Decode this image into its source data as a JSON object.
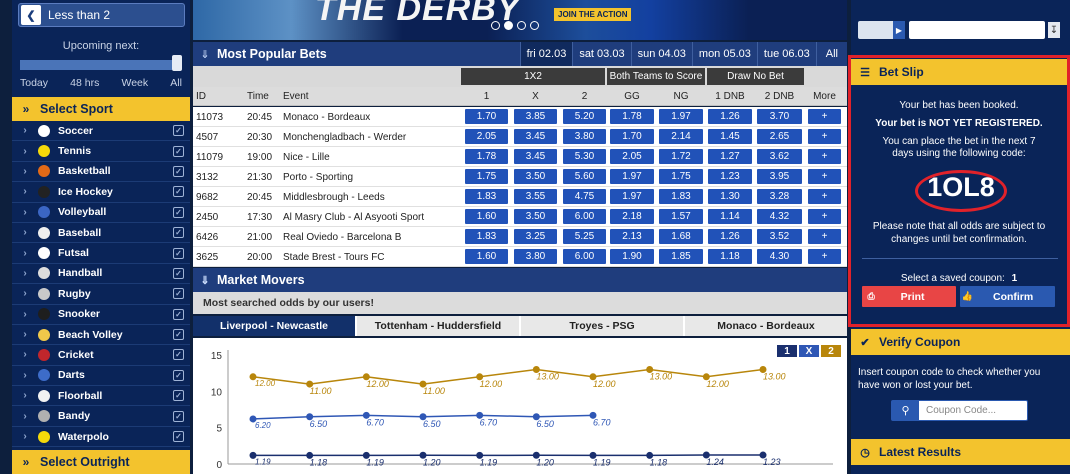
{
  "sidebar": {
    "range_select": "Less than 2",
    "upcoming_label": "Upcoming next:",
    "ranges": [
      "Today",
      "48 hrs",
      "Week",
      "All"
    ],
    "select_sport": "Select Sport",
    "sports": [
      {
        "name": "Soccer",
        "color": "#ffffff"
      },
      {
        "name": "Tennis",
        "color": "#f5d90a"
      },
      {
        "name": "Basketball",
        "color": "#e26a17"
      },
      {
        "name": "Ice Hockey",
        "color": "#222222"
      },
      {
        "name": "Volleyball",
        "color": "#3b66c4"
      },
      {
        "name": "Baseball",
        "color": "#eeeeee"
      },
      {
        "name": "Futsal",
        "color": "#ffffff"
      },
      {
        "name": "Handball",
        "color": "#dddddd"
      },
      {
        "name": "Rugby",
        "color": "#c9c9c9"
      },
      {
        "name": "Snooker",
        "color": "#1e1e1e"
      },
      {
        "name": "Beach Volley",
        "color": "#f0c84a"
      },
      {
        "name": "Cricket",
        "color": "#c0262c"
      },
      {
        "name": "Darts",
        "color": "#3d6cc9"
      },
      {
        "name": "Floorball",
        "color": "#f2f2f2"
      },
      {
        "name": "Bandy",
        "color": "#b0b0b0"
      },
      {
        "name": "Waterpolo",
        "color": "#f5d90a"
      }
    ],
    "select_outright": "Select Outright"
  },
  "banner": {
    "text": "THE DERBY",
    "cta": "JOIN THE ACTION"
  },
  "popular": {
    "title": "Most Popular Bets",
    "date_tabs": [
      "fri 02.03",
      "sat 03.03",
      "sun 04.03",
      "mon 05.03",
      "tue 06.03",
      "All"
    ],
    "groups": [
      "1X2",
      "Both Teams to Score",
      "Draw No Bet"
    ],
    "columns": [
      "ID",
      "Time",
      "Event",
      "1",
      "X",
      "2",
      "GG",
      "NG",
      "1 DNB",
      "2 DNB",
      "More"
    ],
    "rows": [
      {
        "id": "11073",
        "time": "20:45",
        "event": "Monaco - Bordeaux",
        "o1": "1.70",
        "ox": "3.85",
        "o2": "5.20",
        "gg": "1.78",
        "ng": "1.97",
        "dnb1": "1.26",
        "dnb2": "3.70",
        "more": "+"
      },
      {
        "id": "4507",
        "time": "20:30",
        "event": "Monchengladbach - Werder",
        "o1": "2.05",
        "ox": "3.45",
        "o2": "3.80",
        "gg": "1.70",
        "ng": "2.14",
        "dnb1": "1.45",
        "dnb2": "2.65",
        "more": "+"
      },
      {
        "id": "11079",
        "time": "19:00",
        "event": "Nice - Lille",
        "o1": "1.78",
        "ox": "3.45",
        "o2": "5.30",
        "gg": "2.05",
        "ng": "1.72",
        "dnb1": "1.27",
        "dnb2": "3.62",
        "more": "+"
      },
      {
        "id": "3132",
        "time": "21:30",
        "event": "Porto - Sporting",
        "o1": "1.75",
        "ox": "3.50",
        "o2": "5.60",
        "gg": "1.97",
        "ng": "1.75",
        "dnb1": "1.23",
        "dnb2": "3.95",
        "more": "+"
      },
      {
        "id": "9682",
        "time": "20:45",
        "event": "Middlesbrough - Leeds",
        "o1": "1.83",
        "ox": "3.55",
        "o2": "4.75",
        "gg": "1.97",
        "ng": "1.83",
        "dnb1": "1.30",
        "dnb2": "3.28",
        "more": "+"
      },
      {
        "id": "2450",
        "time": "17:30",
        "event": "Al Masry Club - Al Asyooti Sport",
        "o1": "1.60",
        "ox": "3.50",
        "o2": "6.00",
        "gg": "2.18",
        "ng": "1.57",
        "dnb1": "1.14",
        "dnb2": "4.32",
        "more": "+"
      },
      {
        "id": "6426",
        "time": "21:00",
        "event": "Real Oviedo - Barcelona B",
        "o1": "1.83",
        "ox": "3.25",
        "o2": "5.25",
        "gg": "2.13",
        "ng": "1.68",
        "dnb1": "1.26",
        "dnb2": "3.52",
        "more": "+"
      },
      {
        "id": "3625",
        "time": "20:00",
        "event": "Stade Brest - Tours FC",
        "o1": "1.60",
        "ox": "3.80",
        "o2": "6.00",
        "gg": "1.90",
        "ng": "1.85",
        "dnb1": "1.18",
        "dnb2": "4.30",
        "more": "+"
      }
    ]
  },
  "movers": {
    "title": "Market Movers",
    "subtitle": "Most searched odds by our users!",
    "tabs": [
      "Liverpool - Newcastle",
      "Tottenham - Huddersfield",
      "Troyes - PSG",
      "Monaco - Bordeaux"
    ],
    "legend": [
      "1",
      "X",
      "2"
    ],
    "colors": {
      "s1": "#1a2f6e",
      "sx": "#2f57b5",
      "s2": "#b8860b"
    }
  },
  "chart_data": {
    "type": "line",
    "ylim": [
      0,
      15
    ],
    "yticks": [
      "0",
      "5",
      "10",
      "15"
    ],
    "series": [
      {
        "name": "2",
        "values": [
          12.0,
          11.0,
          12.0,
          11.0,
          12.0,
          13.0,
          12.0,
          13.0,
          12.0,
          13.0
        ],
        "labels": [
          "12.00",
          "11.00",
          "12.00",
          "11.00",
          "12.00",
          "13.00",
          "12.00",
          "13.00",
          "12.00",
          "13.00"
        ]
      },
      {
        "name": "X",
        "values": [
          6.2,
          6.5,
          6.7,
          6.5,
          6.7,
          6.5,
          6.7
        ],
        "labels": [
          "6.20",
          "6.50",
          "6.70",
          "6.50",
          "6.70",
          "6.50",
          "6.70"
        ]
      },
      {
        "name": "1",
        "values": [
          1.19,
          1.18,
          1.19,
          1.2,
          1.19,
          1.2,
          1.19,
          1.18,
          1.24,
          1.23
        ],
        "labels": [
          "1.19",
          "1.18",
          "1.19",
          "1.20",
          "1.19",
          "1.20",
          "1.19",
          "1.18",
          "1.24",
          "1.23"
        ]
      }
    ]
  },
  "topbar": {
    "doc_icon": "document-icon"
  },
  "betslip": {
    "title": "Bet Slip",
    "line1": "Your bet has been booked.",
    "line2": "Your bet is NOT YET REGISTERED.",
    "line3": "You can place the bet in the next 7 days using the following code:",
    "code": "1OL8",
    "note": "Please note that all odds are subject to changes until bet confirmation.",
    "coupon_label": "Select a saved coupon:",
    "coupon_count": "1",
    "print": "Print",
    "confirm": "Confirm"
  },
  "verify": {
    "title": "Verify Coupon",
    "text": "Insert coupon code to check whether you have won or lost your bet.",
    "placeholder": "Coupon Code..."
  },
  "latest": {
    "title": "Latest Results"
  }
}
